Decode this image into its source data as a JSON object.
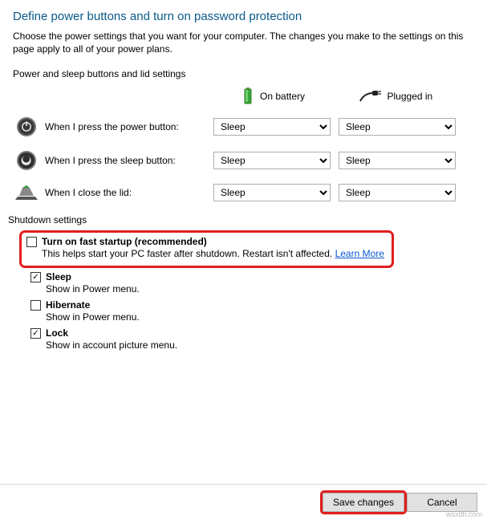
{
  "title": "Define power buttons and turn on password protection",
  "description": "Choose the power settings that you want for your computer. The changes you make to the settings on this page apply to all of your power plans.",
  "buttons_section_label": "Power and sleep buttons and lid settings",
  "cols": {
    "battery": "On battery",
    "plugged": "Plugged in"
  },
  "rows": {
    "power": {
      "label": "When I press the power button:",
      "battery": "Sleep",
      "plugged": "Sleep"
    },
    "sleep": {
      "label": "When I press the sleep button:",
      "battery": "Sleep",
      "plugged": "Sleep"
    },
    "lid": {
      "label": "When I close the lid:",
      "battery": "Sleep",
      "plugged": "Sleep"
    }
  },
  "shutdown_label": "Shutdown settings",
  "fast_startup": {
    "title": "Turn on fast startup (recommended)",
    "desc_prefix": "This helps start your PC faster after shutdown. Restart isn't affected. ",
    "learn_more": "Learn More"
  },
  "opts": {
    "sleep": {
      "title": "Sleep",
      "desc": "Show in Power menu."
    },
    "hibernate": {
      "title": "Hibernate",
      "desc": "Show in Power menu."
    },
    "lock": {
      "title": "Lock",
      "desc": "Show in account picture menu."
    }
  },
  "footer": {
    "save": "Save changes",
    "cancel": "Cancel"
  },
  "watermark": "wsxdh.com"
}
